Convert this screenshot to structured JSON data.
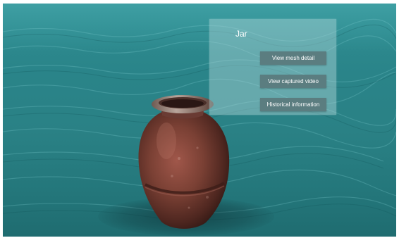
{
  "panel": {
    "title": "Jar",
    "buttons": [
      {
        "label": "View mesh detail"
      },
      {
        "label": "View captured video"
      },
      {
        "label": "Historical information"
      }
    ]
  },
  "scene": {
    "object_name": "jar",
    "colors": {
      "water": "#2a8489",
      "seabed": "#24777b",
      "panel": "#afd7da",
      "button": "#5b7d80",
      "jar": "#7a4034"
    }
  }
}
